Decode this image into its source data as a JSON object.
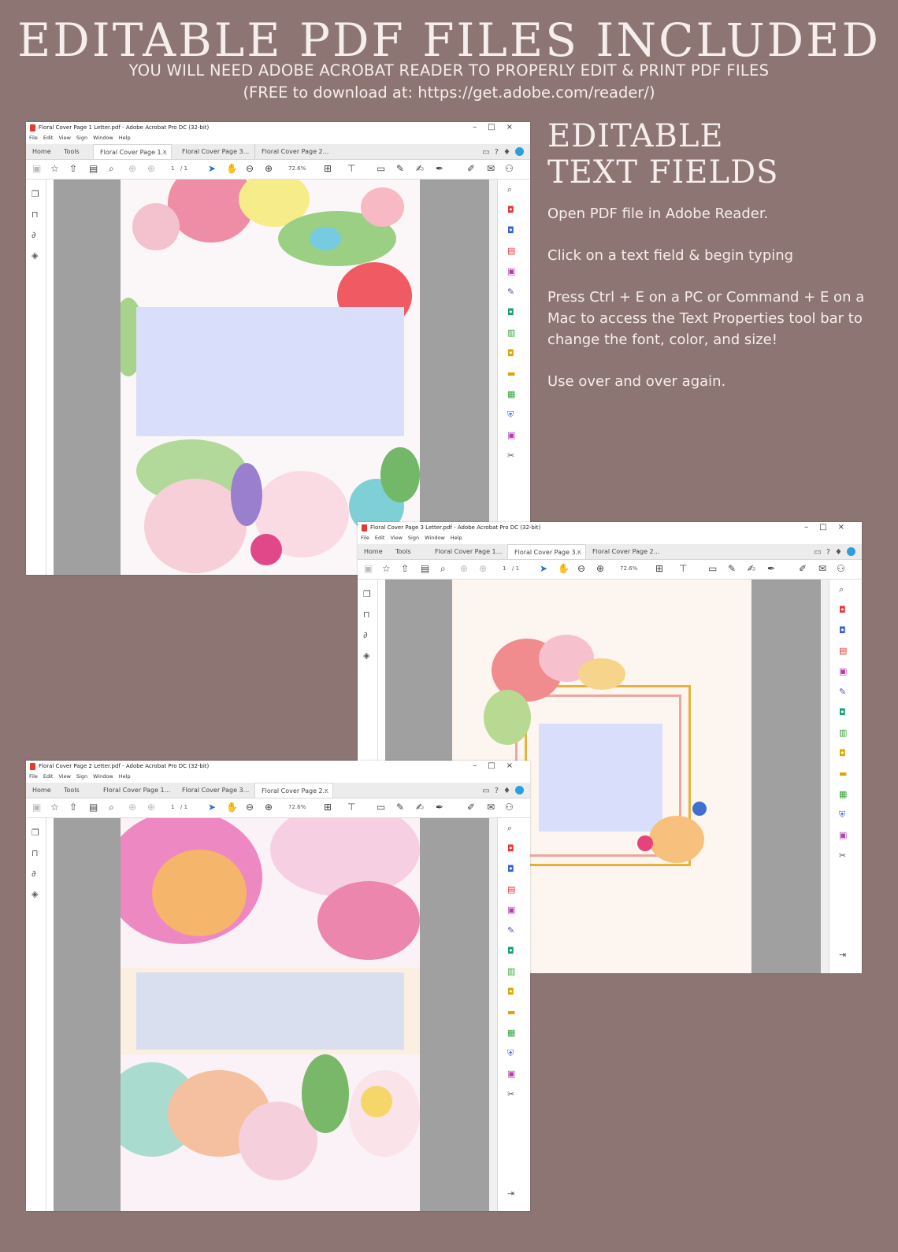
{
  "header": {
    "title": "EDITABLE PDF FILES INCLUDED",
    "subtitle": "YOU WILL NEED ADOBE ACROBAT READER TO PROPERLY EDIT & PRINT PDF FILES",
    "note": "(FREE to download at: https://get.adobe.com/reader/)"
  },
  "side": {
    "title_line1": "EDITABLE",
    "title_line2": "TEXT FIELDS",
    "p1": "Open PDF file in Adobe Reader.",
    "p2": "Click on a text field & begin typing",
    "p3": "Press Ctrl + E on a PC or Command + E on a Mac to access the Text Properties tool bar to change the font, color, and size!",
    "p4": "Use over and over again."
  },
  "menu": [
    "File",
    "Edit",
    "View",
    "Sign",
    "Window",
    "Help"
  ],
  "tabs": {
    "home": "Home",
    "tools": "Tools",
    "close": "×"
  },
  "toolbar": {
    "page_current": "1",
    "page_total": "/ 1",
    "zoom": "72.6%"
  },
  "windows": [
    {
      "title": "Floral Cover Page 1 Letter.pdf - Adobe Acrobat Pro DC (32-bit)",
      "doc_tabs": [
        "Floral Cover Page 1...",
        "Floral Cover Page 3...",
        "Floral Cover Page 2..."
      ],
      "active_tab": 0
    },
    {
      "title": "Floral Cover Page 3 Letter.pdf - Adobe Acrobat Pro DC (32-bit)",
      "doc_tabs": [
        "Floral Cover Page 1...",
        "Floral Cover Page 3...",
        "Floral Cover Page 2..."
      ],
      "active_tab": 1
    },
    {
      "title": "Floral Cover Page 2 Letter.pdf - Adobe Acrobat Pro DC (32-bit)",
      "doc_tabs": [
        "Floral Cover Page 1...",
        "Floral Cover Page 3...",
        "Floral Cover Page 2..."
      ],
      "active_tab": 2
    }
  ],
  "colors": {
    "background": "#8d7573",
    "text": "#f6eeec",
    "field": "#d9defa",
    "acrobat_red": "#e23a2f"
  }
}
